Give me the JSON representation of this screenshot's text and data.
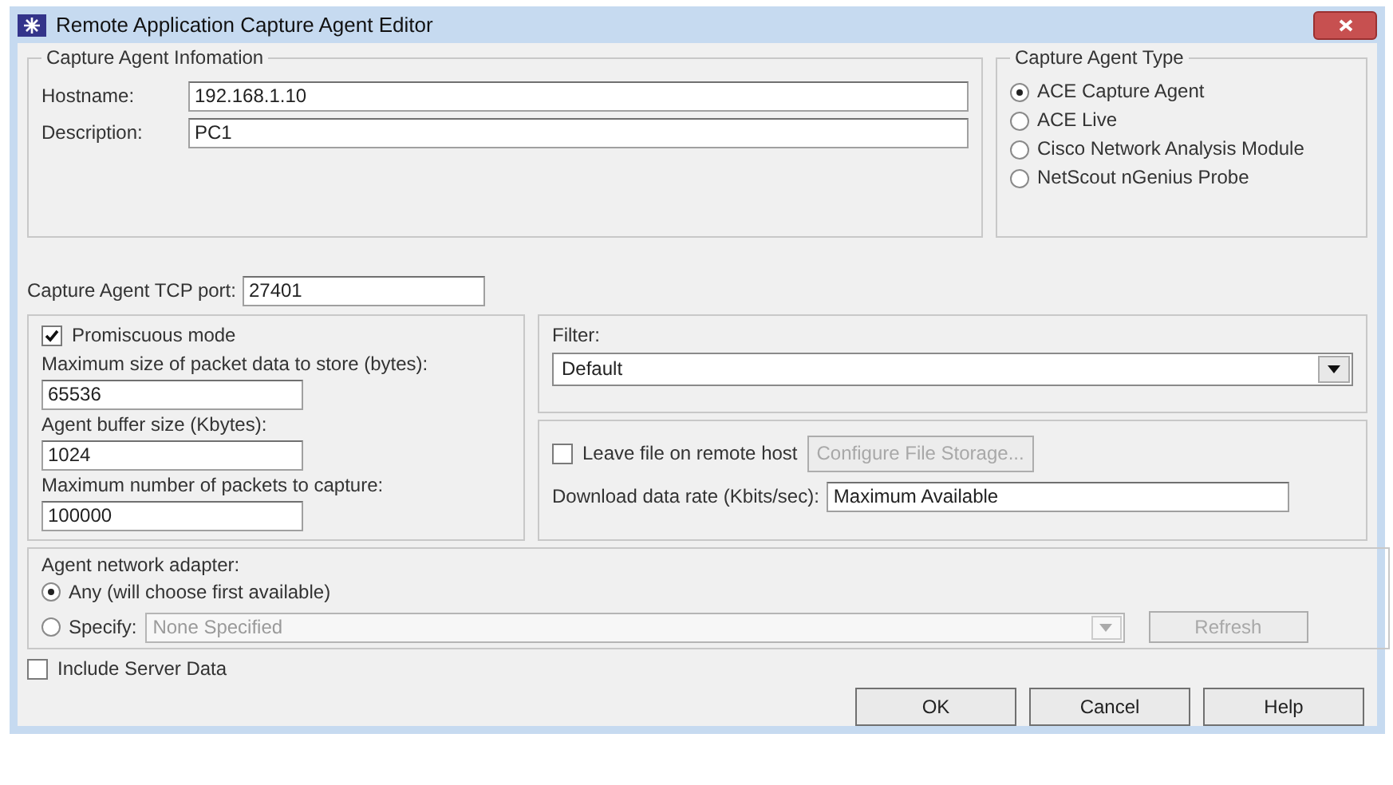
{
  "window": {
    "title": "Remote Application Capture Agent Editor"
  },
  "agent_info": {
    "legend": "Capture Agent Infomation",
    "fields": [
      {
        "label": "Hostname:",
        "value": "192.168.1.10"
      },
      {
        "label": "Description:",
        "value": "PC1"
      }
    ]
  },
  "agent_type": {
    "legend": "Capture Agent Type",
    "options": [
      {
        "label": "ACE Capture Agent",
        "selected": true
      },
      {
        "label": "ACE Live",
        "selected": false
      },
      {
        "label": "Cisco Network Analysis Module",
        "selected": false
      },
      {
        "label": "NetScout nGenius Probe",
        "selected": false
      }
    ]
  },
  "tcp_port": {
    "label": "Capture Agent TCP port:",
    "value": "27401"
  },
  "capture": {
    "promiscuous": {
      "label": "Promiscuous mode",
      "checked": true
    },
    "fields": [
      {
        "label": "Maximum size of packet data to store (bytes):",
        "value": "65536"
      },
      {
        "label": "Agent buffer size (Kbytes):",
        "value": "1024"
      },
      {
        "label": "Maximum number of packets to capture:",
        "value": "100000"
      }
    ]
  },
  "filter": {
    "label": "Filter:",
    "value": "Default"
  },
  "storage": {
    "leave_file": {
      "label": "Leave file on remote host",
      "checked": false
    },
    "configure_button": {
      "label": "Configure File Storage...",
      "disabled": true
    },
    "rate": {
      "label": "Download data rate (Kbits/sec):",
      "value": "Maximum Available"
    }
  },
  "adapter": {
    "label": "Agent network adapter:",
    "options": [
      {
        "label": "Any (will choose first available)",
        "selected": true
      },
      {
        "label": "Specify:",
        "selected": false
      }
    ],
    "specify_value": "None Specified",
    "refresh": {
      "label": "Refresh",
      "disabled": true
    }
  },
  "include_server_data": {
    "label": "Include Server Data",
    "checked": false
  },
  "buttons": [
    {
      "label": "OK"
    },
    {
      "label": "Cancel"
    },
    {
      "label": "Help"
    }
  ]
}
